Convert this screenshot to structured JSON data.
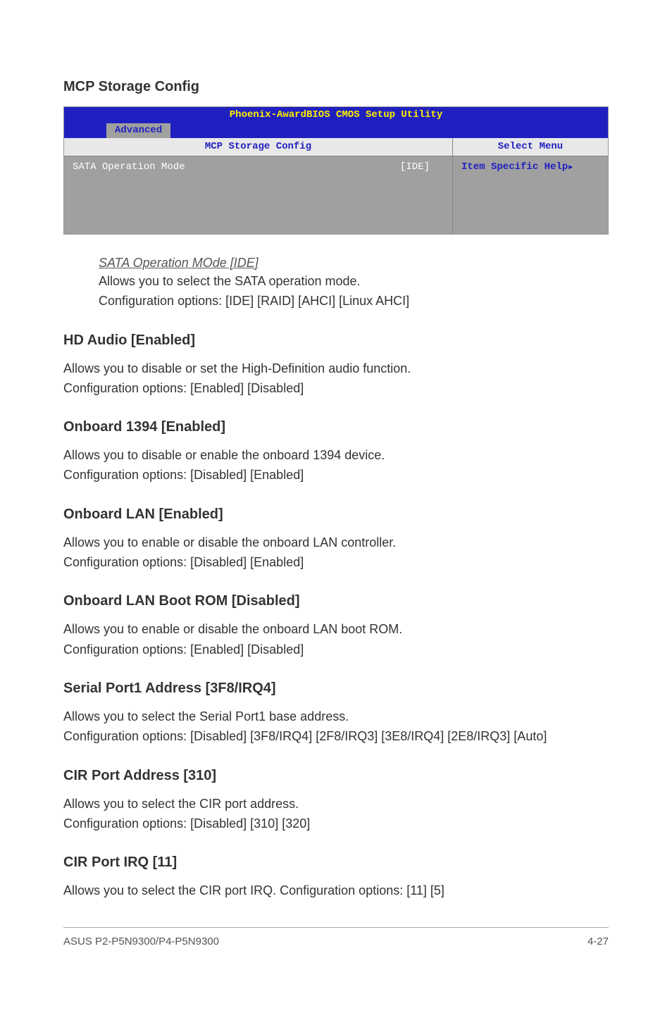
{
  "mcp_storage": {
    "heading": "MCP Storage Config",
    "bios": {
      "title": "Phoenix-AwardBIOS CMOS Setup Utility",
      "tab": "Advanced",
      "left_header": "MCP Storage Config",
      "right_header": "Select Menu",
      "row_label": "SATA Operation Mode",
      "row_value": "[IDE]",
      "help_text": "Item Specific Help"
    },
    "sub": {
      "title": "SATA Operation MOde [IDE]",
      "line1": "Allows you to select the SATA operation mode.",
      "line2": "Configuration options: [IDE] [RAID] [AHCI] [Linux AHCI]"
    }
  },
  "hd_audio": {
    "heading": "HD Audio [Enabled]",
    "line1": "Allows you to disable or set the High-Definition audio function.",
    "line2": "Configuration options: [Enabled] [Disabled]"
  },
  "onboard_1394": {
    "heading": "Onboard 1394 [Enabled]",
    "line1": "Allows you to disable or enable the onboard 1394 device.",
    "line2": "Configuration options: [Disabled] [Enabled]"
  },
  "onboard_lan": {
    "heading": "Onboard LAN [Enabled]",
    "line1": "Allows you to enable or disable the onboard LAN controller.",
    "line2": "Configuration options: [Disabled] [Enabled]"
  },
  "onboard_lan_boot": {
    "heading": "Onboard LAN Boot ROM [Disabled]",
    "line1": "Allows you to enable or disable the onboard LAN boot ROM.",
    "line2": "Configuration options: [Enabled] [Disabled]"
  },
  "serial_port1": {
    "heading": "Serial Port1 Address [3F8/IRQ4]",
    "line1": "Allows you to select the Serial Port1 base address.",
    "line2": "Configuration options: [Disabled] [3F8/IRQ4] [2F8/IRQ3] [3E8/IRQ4] [2E8/IRQ3] [Auto]"
  },
  "cir_port_addr": {
    "heading": "CIR Port Address [310]",
    "line1": "Allows you to select the CIR port address.",
    "line2": "Configuration options: [Disabled] [310] [320]"
  },
  "cir_port_irq": {
    "heading": "CIR Port IRQ [11]",
    "line1": "Allows you to select the CIR port IRQ. Configuration options: [11] [5]"
  },
  "footer": {
    "left": "ASUS P2-P5N9300/P4-P5N9300",
    "right": "4-27"
  }
}
